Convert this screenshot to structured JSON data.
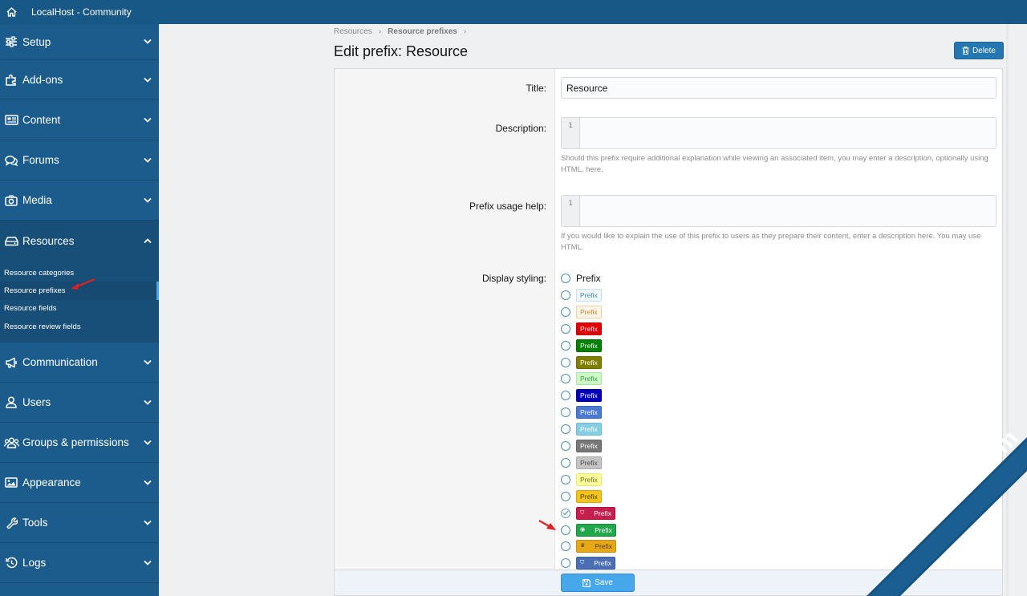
{
  "topbar": {
    "title": "LocalHost - Community",
    "home_icon": "home-icon"
  },
  "sidebar": {
    "items": [
      {
        "label": "Setup",
        "icon": "sliders-icon"
      },
      {
        "label": "Add-ons",
        "icon": "puzzle-icon"
      },
      {
        "label": "Content",
        "icon": "newspaper-icon"
      },
      {
        "label": "Forums",
        "icon": "comments-icon"
      },
      {
        "label": "Media",
        "icon": "camera-icon"
      },
      {
        "label": "Resources",
        "icon": "hdd-icon",
        "expanded": true
      },
      {
        "label": "Communication",
        "icon": "megaphone-icon"
      },
      {
        "label": "Users",
        "icon": "user-icon"
      },
      {
        "label": "Groups & permissions",
        "icon": "users-icon"
      },
      {
        "label": "Appearance",
        "icon": "image-icon"
      },
      {
        "label": "Tools",
        "icon": "wrench-icon"
      },
      {
        "label": "Logs",
        "icon": "history-icon"
      }
    ],
    "resources_sub": [
      {
        "label": "Resource categories"
      },
      {
        "label": "Resource prefixes",
        "active": true
      },
      {
        "label": "Resource fields"
      },
      {
        "label": "Resource review fields"
      }
    ]
  },
  "breadcrumb": {
    "parent": "Resources",
    "current": "Resource prefixes"
  },
  "page": {
    "title": "Edit prefix: Resource",
    "delete_label": "Delete"
  },
  "form": {
    "title_label": "Title:",
    "title_value": "Resource",
    "description_label": "Description:",
    "description_line": "1",
    "description_hint": "Should this prefix require additional explanation while viewing an associated item, you may enter a description, optionally using HTML, here.",
    "usage_label": "Prefix usage help:",
    "usage_line": "1",
    "usage_hint": "If you would like to explain the use of this prefix to users as they prepare their content, enter a description here. You may use HTML.",
    "styling_label": "Display styling:",
    "styles": [
      {
        "label": "Prefix",
        "kind": "plain"
      },
      {
        "label": "Prefix",
        "bg": "#f0f7fc",
        "fg": "#4b87b5",
        "border": "#c7ddf0"
      },
      {
        "label": "Prefix",
        "bg": "#fff5e6",
        "fg": "#d0843a",
        "border": "#f1cfa0"
      },
      {
        "label": "Prefix",
        "bg": "#e00000",
        "fg": "#ffffff",
        "border": "#c00000"
      },
      {
        "label": "Prefix",
        "bg": "#008000",
        "fg": "#ffffff",
        "border": "#006b00"
      },
      {
        "label": "Prefix",
        "bg": "#808000",
        "fg": "#ffffff",
        "border": "#6b6b00"
      },
      {
        "label": "Prefix",
        "bg": "#ccf9c8",
        "fg": "#3b9a3b",
        "border": "#a8e4a3"
      },
      {
        "label": "Prefix",
        "bg": "#0000ba",
        "fg": "#ffffff",
        "border": "#00009a"
      },
      {
        "label": "Prefix",
        "bg": "#4b7bd0",
        "fg": "#ffffff",
        "border": "#3d68b5"
      },
      {
        "label": "Prefix",
        "bg": "#86cfe2",
        "fg": "#ffffff",
        "border": "#6bbcd2"
      },
      {
        "label": "Prefix",
        "bg": "#777777",
        "fg": "#ffffff",
        "border": "#666666"
      },
      {
        "label": "Prefix",
        "bg": "#c4c4c4",
        "fg": "#4d4d4d",
        "border": "#aaaaaa"
      },
      {
        "label": "Prefix",
        "bg": "#ffff99",
        "fg": "#6b6b3a",
        "border": "#e6e67a"
      },
      {
        "label": "Prefix",
        "bg": "#f5c31d",
        "fg": "#4a3a00",
        "border": "#d9a800"
      },
      {
        "label": "Prefix",
        "bg": "#c61f4d",
        "fg": "#ffffff",
        "border": "#a8163e",
        "icon": "shield-icon",
        "checked": true
      },
      {
        "label": "Prefix",
        "bg": "#21a84a",
        "fg": "#ffffff",
        "border": "#198a3b",
        "icon": "circle-icon"
      },
      {
        "label": "Prefix",
        "bg": "#e6a817",
        "fg": "#5a3c00",
        "border": "#c98f0a",
        "icon": "crown-icon"
      },
      {
        "label": "Prefix",
        "bg": "#4a6fb5",
        "fg": "#ffffff",
        "border": "#3c5d9c",
        "icon": "shield-icon"
      }
    ],
    "save_label": "Save"
  },
  "watermark": {
    "text": "XenBD.Com"
  },
  "colors": {
    "topbar": "#185886",
    "sidebar": "#1c5c8c",
    "accent": "#47a7eb",
    "save": "#46a7ea"
  }
}
